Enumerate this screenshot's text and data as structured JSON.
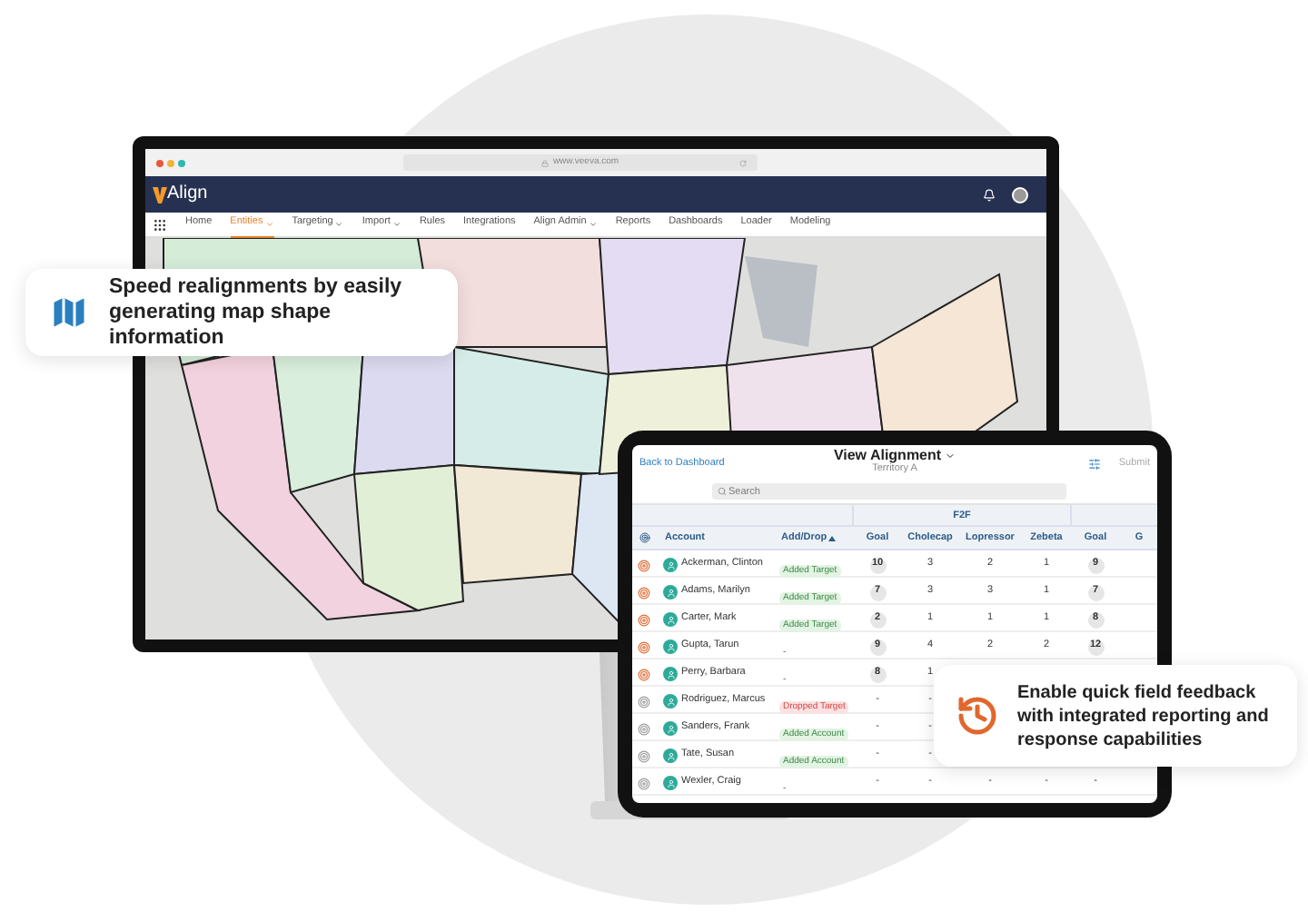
{
  "monitor": {
    "browser": {
      "url": "www.veeva.com"
    },
    "app": {
      "logo": "Align"
    },
    "nav": [
      {
        "label": "Home",
        "selected": false,
        "dropdown": false
      },
      {
        "label": "Entities",
        "selected": true,
        "dropdown": true
      },
      {
        "label": "Targeting",
        "selected": false,
        "dropdown": true
      },
      {
        "label": "Import",
        "selected": false,
        "dropdown": true
      },
      {
        "label": "Rules",
        "selected": false,
        "dropdown": false
      },
      {
        "label": "Integrations",
        "selected": false,
        "dropdown": false
      },
      {
        "label": "Align Admin",
        "selected": false,
        "dropdown": true
      },
      {
        "label": "Reports",
        "selected": false,
        "dropdown": false
      },
      {
        "label": "Dashboards",
        "selected": false,
        "dropdown": false
      },
      {
        "label": "Loader",
        "selected": false,
        "dropdown": false
      },
      {
        "label": "Modeling",
        "selected": false,
        "dropdown": false
      }
    ]
  },
  "tablet": {
    "back_link": "Back to Dashboard",
    "title": "View Alignment",
    "subtitle": "Territory A",
    "submit": "Submit",
    "search": {
      "placeholder": "Search"
    },
    "group_header": "F2F",
    "columns": [
      {
        "label": "Account",
        "sorted": false
      },
      {
        "label": "Add/Drop",
        "sorted": true
      },
      {
        "label": "Goal",
        "sorted": false
      },
      {
        "label": "Cholecap",
        "sorted": false
      },
      {
        "label": "Lopressor",
        "sorted": false
      },
      {
        "label": "Zebeta",
        "sorted": false
      },
      {
        "label": "Goal",
        "sorted": false
      },
      {
        "label": "G",
        "sorted": false
      }
    ],
    "rows": [
      {
        "name": "Ackerman, Clinton",
        "targeted": true,
        "status": {
          "kind": "added",
          "label": "Added Target"
        },
        "goal_set": true,
        "values": [
          "10",
          "3",
          "2",
          "1",
          "9"
        ]
      },
      {
        "name": "Adams, Marilyn",
        "targeted": true,
        "status": {
          "kind": "added",
          "label": "Added Target"
        },
        "goal_set": true,
        "values": [
          "7",
          "3",
          "3",
          "1",
          "7"
        ]
      },
      {
        "name": "Carter, Mark",
        "targeted": true,
        "status": {
          "kind": "added",
          "label": "Added Target"
        },
        "goal_set": true,
        "values": [
          "2",
          "1",
          "1",
          "1",
          "8"
        ]
      },
      {
        "name": "Gupta, Tarun",
        "targeted": true,
        "status": {
          "kind": "none",
          "label": "-"
        },
        "goal_set": true,
        "values": [
          "9",
          "4",
          "2",
          "2",
          "12"
        ]
      },
      {
        "name": "Perry, Barbara",
        "targeted": true,
        "status": {
          "kind": "none",
          "label": "-"
        },
        "goal_set": true,
        "values": [
          "8",
          "1"
        ]
      },
      {
        "name": "Rodriguez, Marcus",
        "targeted": false,
        "status": {
          "kind": "dropped",
          "label": "Dropped Target"
        },
        "goal_set": false,
        "values": [
          "-",
          "-"
        ]
      },
      {
        "name": "Sanders, Frank",
        "targeted": false,
        "status": {
          "kind": "added",
          "label": "Added Account"
        },
        "goal_set": false,
        "values": [
          "-",
          "-"
        ]
      },
      {
        "name": "Tate, Susan",
        "targeted": false,
        "status": {
          "kind": "added",
          "label": "Added Account"
        },
        "goal_set": false,
        "values": [
          "-",
          "-"
        ]
      },
      {
        "name": "Wexler, Craig",
        "targeted": false,
        "status": {
          "kind": "none",
          "label": "-"
        },
        "goal_set": false,
        "values": [
          "-",
          "-",
          "-",
          "-",
          "-"
        ]
      }
    ]
  },
  "callouts": [
    {
      "kind": "map",
      "text": "Speed realignments by easily generating map shape information"
    },
    {
      "kind": "refresh",
      "text": "Enable quick field feedback with integrated reporting and response capabilities"
    }
  ]
}
